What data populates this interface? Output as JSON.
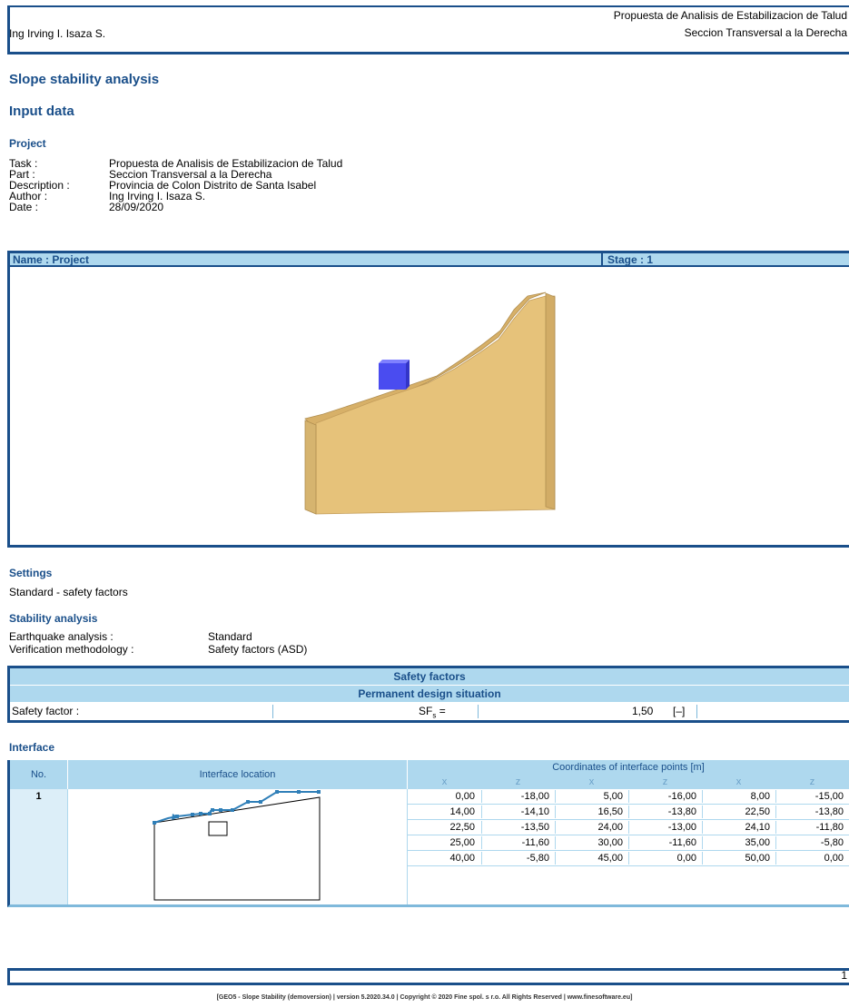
{
  "header": {
    "author": "Ing Irving I. Isaza S.",
    "title_line1": "Propuesta de Analisis de Estabilizacion de Talud",
    "title_line2": "Seccion Transversal a la Derecha"
  },
  "doc_title": "Slope stability analysis",
  "section_input": "Input data",
  "project": {
    "heading": "Project",
    "rows": [
      {
        "label": "Task :",
        "value": "Propuesta de Analisis de Estabilizacion de Talud"
      },
      {
        "label": "Part :",
        "value": "Seccion Transversal a la Derecha"
      },
      {
        "label": "Description :",
        "value": "Provincia de Colon Distrito de Santa Isabel"
      },
      {
        "label": "Author :",
        "value": "Ing Irving I. Isaza S."
      },
      {
        "label": "Date :",
        "value": "28/09/2020"
      }
    ]
  },
  "view": {
    "name_label": "Name : Project",
    "stage_label": "Stage : 1"
  },
  "settings": {
    "heading": "Settings",
    "value": "Standard - safety factors"
  },
  "stability": {
    "heading": "Stability analysis",
    "rows": [
      {
        "label": "Earthquake analysis :",
        "value": "Standard"
      },
      {
        "label": "Verification methodology :",
        "value": "Safety factors (ASD)"
      }
    ]
  },
  "safety_table": {
    "title": "Safety factors",
    "subtitle": "Permanent design situation",
    "row_label": "Safety factor :",
    "symbol": "SF",
    "symbol_sub": "s",
    "symbol_eq": "=",
    "value": "1,50",
    "unit": "[–]"
  },
  "interface": {
    "heading": "Interface",
    "col_no": "No.",
    "col_location": "Interface location",
    "col_coords": "Coordinates of interface points [m]",
    "sub_cols": [
      "x",
      "z",
      "x",
      "z",
      "x",
      "z"
    ],
    "number": "1",
    "rows": [
      [
        "0,00",
        "-18,00",
        "5,00",
        "-16,00",
        "8,00",
        "-15,00"
      ],
      [
        "14,00",
        "-14,10",
        "16,50",
        "-13,80",
        "22,50",
        "-13,80"
      ],
      [
        "22,50",
        "-13,50",
        "24,00",
        "-13,00",
        "24,10",
        "-11,80"
      ],
      [
        "25,00",
        "-11,60",
        "30,00",
        "-11,60",
        "35,00",
        "-5,80"
      ],
      [
        "40,00",
        "-5,80",
        "45,00",
        "0,00",
        "50,00",
        "0,00"
      ]
    ]
  },
  "footer": {
    "page": "1",
    "credit": "[GEO5 - Slope Stability (demoversion) | version 5.2020.34.0 | Copyright © 2020 Fine spol. s r.o. All Rights Reserved | www.finesoftware.eu]"
  },
  "colors": {
    "brand_blue": "#1a4f8a",
    "header_fill": "#aed8ee",
    "soil": "#e6c27a",
    "load_block": "#4a4cf0"
  }
}
